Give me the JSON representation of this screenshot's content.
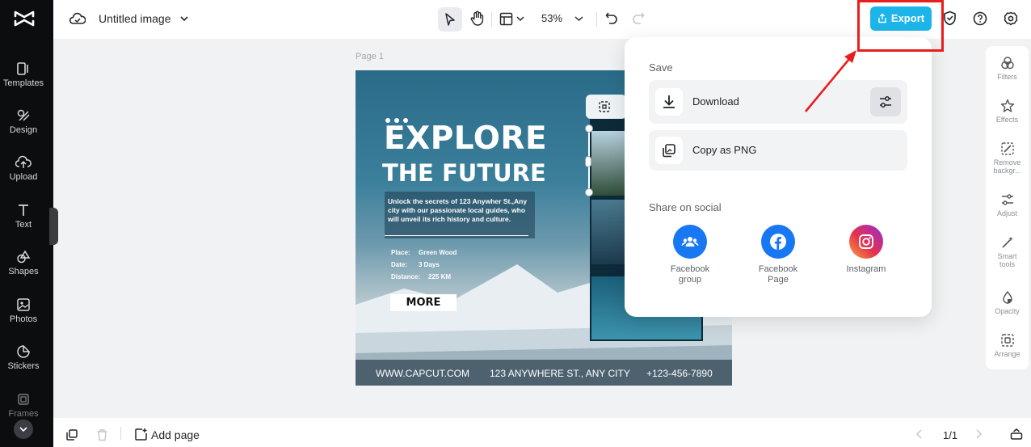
{
  "left_sidebar": {
    "items": [
      {
        "label": "Templates",
        "icon": "templates-icon"
      },
      {
        "label": "Design",
        "icon": "design-icon"
      },
      {
        "label": "Upload",
        "icon": "upload-icon"
      },
      {
        "label": "Text",
        "icon": "text-icon"
      },
      {
        "label": "Shapes",
        "icon": "shapes-icon"
      },
      {
        "label": "Photos",
        "icon": "photos-icon"
      },
      {
        "label": "Stickers",
        "icon": "stickers-icon"
      },
      {
        "label": "Frames",
        "icon": "frames-icon"
      }
    ]
  },
  "topbar": {
    "title": "Untitled image",
    "zoom": "53%",
    "export_label": "Export"
  },
  "canvas": {
    "page_label": "Page 1",
    "design": {
      "headline1": "EXPLORE",
      "headline2": "THE FUTURE",
      "description": "Unlock the secrets of 123 Anywher St.,Any city with our passionate local guides, who will unveil its rich history and culture.",
      "place_label": "Place:",
      "place_value": "Green Wood",
      "date_label": "Date:",
      "date_value": "3 Days",
      "distance_label": "Distance:",
      "distance_value": "225 KM",
      "button": "MORE",
      "website": "WWW.CAPCUT.COM",
      "address": "123 ANYWHERE ST., ANY CITY",
      "phone": "+123-456-7890"
    }
  },
  "export_popup": {
    "save_heading": "Save",
    "download_label": "Download",
    "copy_label": "Copy as PNG",
    "share_heading": "Share on social",
    "social": [
      {
        "label": "Facebook group",
        "line1": "Facebook",
        "line2": "group",
        "color": "#1877f2"
      },
      {
        "label": "Facebook Page",
        "line1": "Facebook",
        "line2": "Page",
        "color": "#1877f2"
      },
      {
        "label": "Instagram",
        "line1": "Instagram",
        "line2": "",
        "color": "#e1306c"
      }
    ]
  },
  "right_tools": {
    "items": [
      {
        "line1": "Filters",
        "line2": ""
      },
      {
        "line1": "Effects",
        "line2": ""
      },
      {
        "line1": "Remove",
        "line2": "backgr..."
      },
      {
        "line1": "Adjust",
        "line2": ""
      },
      {
        "line1": "Smart",
        "line2": "tools"
      },
      {
        "line1": "Opacity",
        "line2": ""
      },
      {
        "line1": "Arrange",
        "line2": ""
      }
    ]
  },
  "bottombar": {
    "add_page": "Add page",
    "page_counter": "1/1"
  },
  "colors": {
    "accent": "#1db5e9",
    "highlight_red": "#ea1d1d",
    "sidebar_bg": "#0c0d0f"
  }
}
